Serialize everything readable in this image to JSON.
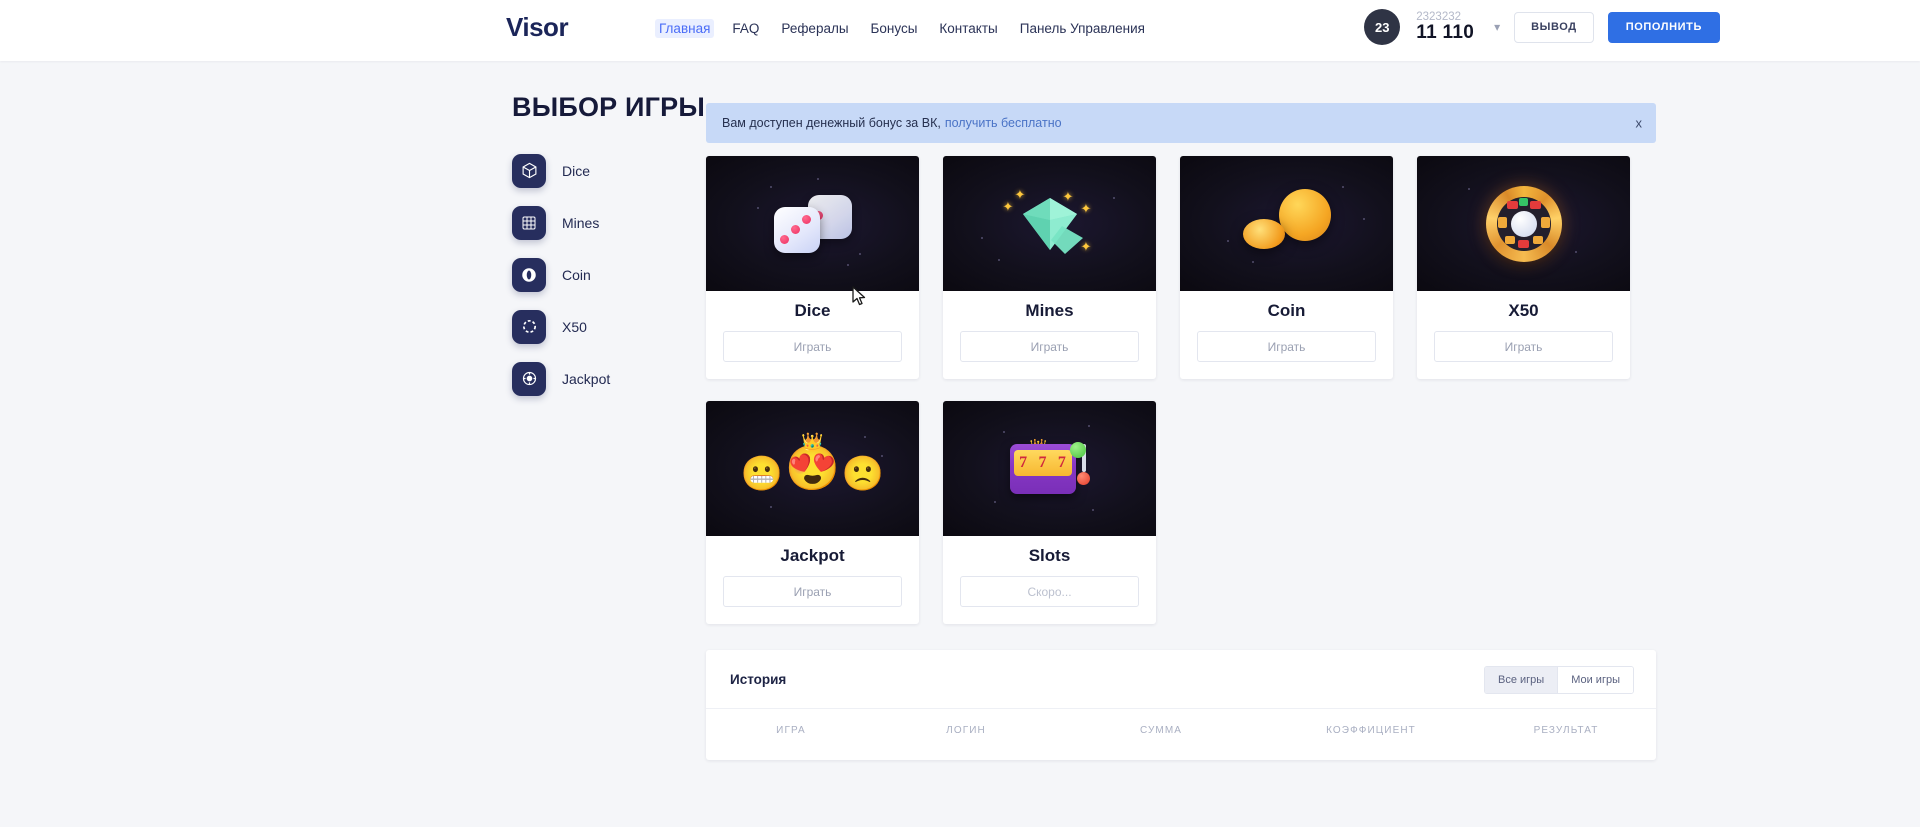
{
  "header": {
    "logo": "Visor",
    "nav": [
      {
        "label": "Главная",
        "active": true
      },
      {
        "label": "FAQ",
        "active": false
      },
      {
        "label": "Рефералы",
        "active": false
      },
      {
        "label": "Бонусы",
        "active": false
      },
      {
        "label": "Контакты",
        "active": false
      },
      {
        "label": "Панель Управления",
        "active": false
      }
    ],
    "user": {
      "avatar_initials": "23",
      "username": "2323232",
      "balance": "11 110",
      "dropdown_icon": "chevron-down-icon"
    },
    "withdraw_label": "вывод",
    "deposit_label": "пополнить",
    "accent_color": "#2f6fe4",
    "nav_active_color": "#4a6cf7"
  },
  "sidebar": {
    "title": "ВЫБОР ИГРЫ",
    "items": [
      {
        "label": "Dice",
        "icon": "cube-icon"
      },
      {
        "label": "Mines",
        "icon": "grid-icon"
      },
      {
        "label": "Coin",
        "icon": "coin-icon"
      },
      {
        "label": "X50",
        "icon": "dashed-circle-icon"
      },
      {
        "label": "Jackpot",
        "icon": "target-icon"
      }
    ]
  },
  "banner": {
    "text": "Вам доступен денежный бонус за ВК,",
    "link": "получить бесплатно",
    "close_label": "x",
    "background": "#c7d9f7"
  },
  "games": [
    {
      "title": "Dice",
      "button": "Играть",
      "available": true,
      "art": "dice"
    },
    {
      "title": "Mines",
      "button": "Играть",
      "available": true,
      "art": "gem"
    },
    {
      "title": "Coin",
      "button": "Играть",
      "available": true,
      "art": "coin"
    },
    {
      "title": "X50",
      "button": "Играть",
      "available": true,
      "art": "wheel"
    },
    {
      "title": "Jackpot",
      "button": "Играть",
      "available": true,
      "art": "emoji"
    },
    {
      "title": "Slots",
      "button": "Скоро...",
      "available": false,
      "art": "slots"
    }
  ],
  "history": {
    "title": "История",
    "tabs": [
      {
        "label": "Все игры",
        "active": true
      },
      {
        "label": "Мои игры",
        "active": false
      }
    ],
    "columns": [
      "ИГРА",
      "ЛОГИН",
      "СУММА",
      "КОЭФФИЦИЕНТ",
      "РЕЗУЛЬТАТ"
    ],
    "rows": []
  }
}
